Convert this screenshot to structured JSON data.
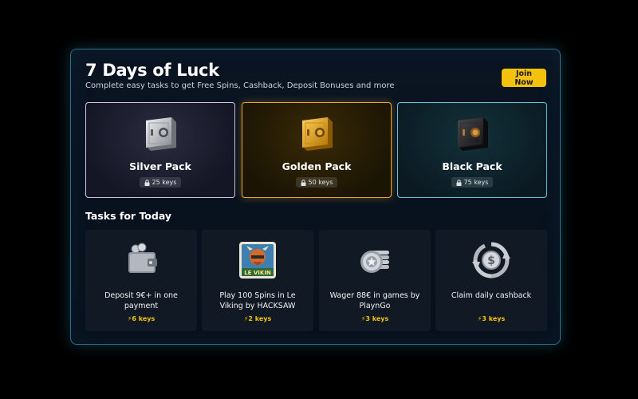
{
  "header": {
    "title": "7 Days of Luck",
    "subtitle": "Complete easy tasks to get Free Spins, Cashback, Deposit Bonuses and more",
    "join_label": "Join Now"
  },
  "packs": [
    {
      "name": "Silver Pack",
      "keys": "25 keys",
      "icon": "silver-safe-icon"
    },
    {
      "name": "Golden Pack",
      "keys": "50 keys",
      "icon": "gold-safe-icon"
    },
    {
      "name": "Black Pack",
      "keys": "75 keys",
      "icon": "black-safe-icon"
    }
  ],
  "tasks_title": "Tasks for Today",
  "tasks": [
    {
      "text": "Deposit 9€+ in one payment",
      "keys": "⚡6 keys",
      "icon": "wallet-icon"
    },
    {
      "text": "Play 100 Spins in Le Viking by HACKSAW",
      "keys": "⚡2 keys",
      "icon": "le-viking-game-icon",
      "game_label": "LE VIKIN"
    },
    {
      "text": "Wager 88€ in games by PlaynGo",
      "keys": "⚡3 keys",
      "icon": "chip-stack-icon"
    },
    {
      "text": "Claim daily cashback",
      "keys": "⚡3 keys",
      "icon": "cashback-icon"
    }
  ],
  "colors": {
    "accent_yellow": "#f4c20d",
    "silver_border": "#c8c8e0",
    "gold_border": "#f0a722",
    "black_border": "#58c9d6",
    "panel_border": "#2a6f86"
  }
}
